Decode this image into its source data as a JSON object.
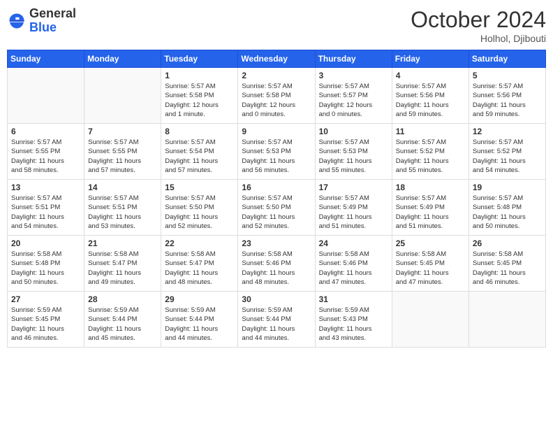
{
  "header": {
    "logo_general": "General",
    "logo_blue": "Blue",
    "month_title": "October 2024",
    "location": "Holhol, Djibouti"
  },
  "weekdays": [
    "Sunday",
    "Monday",
    "Tuesday",
    "Wednesday",
    "Thursday",
    "Friday",
    "Saturday"
  ],
  "weeks": [
    [
      {
        "day": "",
        "info": ""
      },
      {
        "day": "",
        "info": ""
      },
      {
        "day": "1",
        "info": "Sunrise: 5:57 AM\nSunset: 5:58 PM\nDaylight: 12 hours\nand 1 minute."
      },
      {
        "day": "2",
        "info": "Sunrise: 5:57 AM\nSunset: 5:58 PM\nDaylight: 12 hours\nand 0 minutes."
      },
      {
        "day": "3",
        "info": "Sunrise: 5:57 AM\nSunset: 5:57 PM\nDaylight: 12 hours\nand 0 minutes."
      },
      {
        "day": "4",
        "info": "Sunrise: 5:57 AM\nSunset: 5:56 PM\nDaylight: 11 hours\nand 59 minutes."
      },
      {
        "day": "5",
        "info": "Sunrise: 5:57 AM\nSunset: 5:56 PM\nDaylight: 11 hours\nand 59 minutes."
      }
    ],
    [
      {
        "day": "6",
        "info": "Sunrise: 5:57 AM\nSunset: 5:55 PM\nDaylight: 11 hours\nand 58 minutes."
      },
      {
        "day": "7",
        "info": "Sunrise: 5:57 AM\nSunset: 5:55 PM\nDaylight: 11 hours\nand 57 minutes."
      },
      {
        "day": "8",
        "info": "Sunrise: 5:57 AM\nSunset: 5:54 PM\nDaylight: 11 hours\nand 57 minutes."
      },
      {
        "day": "9",
        "info": "Sunrise: 5:57 AM\nSunset: 5:53 PM\nDaylight: 11 hours\nand 56 minutes."
      },
      {
        "day": "10",
        "info": "Sunrise: 5:57 AM\nSunset: 5:53 PM\nDaylight: 11 hours\nand 55 minutes."
      },
      {
        "day": "11",
        "info": "Sunrise: 5:57 AM\nSunset: 5:52 PM\nDaylight: 11 hours\nand 55 minutes."
      },
      {
        "day": "12",
        "info": "Sunrise: 5:57 AM\nSunset: 5:52 PM\nDaylight: 11 hours\nand 54 minutes."
      }
    ],
    [
      {
        "day": "13",
        "info": "Sunrise: 5:57 AM\nSunset: 5:51 PM\nDaylight: 11 hours\nand 54 minutes."
      },
      {
        "day": "14",
        "info": "Sunrise: 5:57 AM\nSunset: 5:51 PM\nDaylight: 11 hours\nand 53 minutes."
      },
      {
        "day": "15",
        "info": "Sunrise: 5:57 AM\nSunset: 5:50 PM\nDaylight: 11 hours\nand 52 minutes."
      },
      {
        "day": "16",
        "info": "Sunrise: 5:57 AM\nSunset: 5:50 PM\nDaylight: 11 hours\nand 52 minutes."
      },
      {
        "day": "17",
        "info": "Sunrise: 5:57 AM\nSunset: 5:49 PM\nDaylight: 11 hours\nand 51 minutes."
      },
      {
        "day": "18",
        "info": "Sunrise: 5:57 AM\nSunset: 5:49 PM\nDaylight: 11 hours\nand 51 minutes."
      },
      {
        "day": "19",
        "info": "Sunrise: 5:57 AM\nSunset: 5:48 PM\nDaylight: 11 hours\nand 50 minutes."
      }
    ],
    [
      {
        "day": "20",
        "info": "Sunrise: 5:58 AM\nSunset: 5:48 PM\nDaylight: 11 hours\nand 50 minutes."
      },
      {
        "day": "21",
        "info": "Sunrise: 5:58 AM\nSunset: 5:47 PM\nDaylight: 11 hours\nand 49 minutes."
      },
      {
        "day": "22",
        "info": "Sunrise: 5:58 AM\nSunset: 5:47 PM\nDaylight: 11 hours\nand 48 minutes."
      },
      {
        "day": "23",
        "info": "Sunrise: 5:58 AM\nSunset: 5:46 PM\nDaylight: 11 hours\nand 48 minutes."
      },
      {
        "day": "24",
        "info": "Sunrise: 5:58 AM\nSunset: 5:46 PM\nDaylight: 11 hours\nand 47 minutes."
      },
      {
        "day": "25",
        "info": "Sunrise: 5:58 AM\nSunset: 5:45 PM\nDaylight: 11 hours\nand 47 minutes."
      },
      {
        "day": "26",
        "info": "Sunrise: 5:58 AM\nSunset: 5:45 PM\nDaylight: 11 hours\nand 46 minutes."
      }
    ],
    [
      {
        "day": "27",
        "info": "Sunrise: 5:59 AM\nSunset: 5:45 PM\nDaylight: 11 hours\nand 46 minutes."
      },
      {
        "day": "28",
        "info": "Sunrise: 5:59 AM\nSunset: 5:44 PM\nDaylight: 11 hours\nand 45 minutes."
      },
      {
        "day": "29",
        "info": "Sunrise: 5:59 AM\nSunset: 5:44 PM\nDaylight: 11 hours\nand 44 minutes."
      },
      {
        "day": "30",
        "info": "Sunrise: 5:59 AM\nSunset: 5:44 PM\nDaylight: 11 hours\nand 44 minutes."
      },
      {
        "day": "31",
        "info": "Sunrise: 5:59 AM\nSunset: 5:43 PM\nDaylight: 11 hours\nand 43 minutes."
      },
      {
        "day": "",
        "info": ""
      },
      {
        "day": "",
        "info": ""
      }
    ]
  ]
}
